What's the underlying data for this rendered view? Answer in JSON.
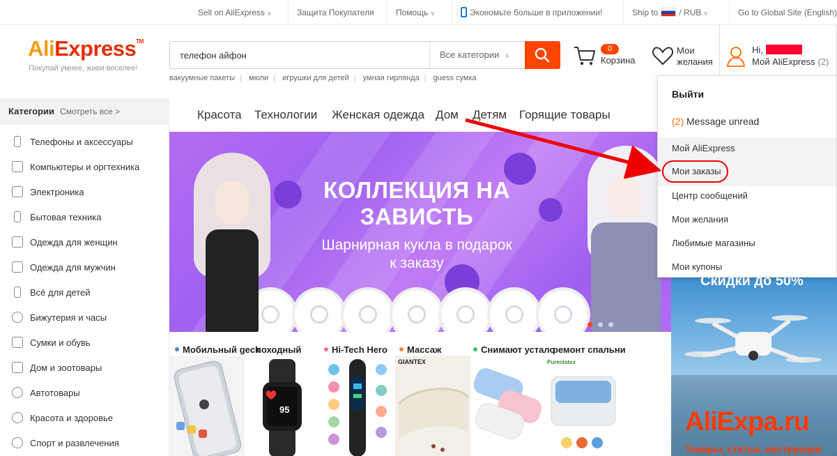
{
  "topbar": {
    "sell": "Sell on AliExpress",
    "protection": "Защита Покупателя",
    "help": "Помощь",
    "app": "Экономьте больше в приложении!",
    "ship_to": "Ship to",
    "currency": "RUB",
    "global": "Go to Global Site (English)"
  },
  "logo": {
    "part1": "Ali",
    "part2": "Express",
    "tm": "TM",
    "tagline": "Покупай умнее, живи веселее!"
  },
  "search": {
    "value": "телефон айфон",
    "category": "Все категории",
    "hotwords": [
      "вакуумные пакеты",
      "мюли",
      "игрушки для детей",
      "умная гирлянда",
      "guess сумка"
    ]
  },
  "cart": {
    "count": "0",
    "label": "Корзина"
  },
  "wishlist": {
    "label": "Мои желания"
  },
  "account": {
    "greeting": "Hi,",
    "my_aliexpress": "Мой AliExpress",
    "count": "(2)"
  },
  "dropdown": {
    "logout": "Выйти",
    "unread_count": "(2)",
    "unread_text": "Message unread",
    "items": [
      "Мой AliExpress",
      "Мои заказы",
      "Центр сообщений",
      "Мои желания",
      "Любимые магазины",
      "Мои купоны"
    ]
  },
  "categories": {
    "title": "Категории",
    "see_all": "Смотреть все >",
    "items": [
      "Телефоны и аксессуары",
      "Компьютеры и оргтехника",
      "Электроника",
      "Бытовая техника",
      "Одежда для женщин",
      "Одежда для мужчин",
      "Всё для детей",
      "Бижутерия и часы",
      "Сумки и обувь",
      "Дом и зоотовары",
      "Автотовары",
      "Красота и здоровье",
      "Спорт и развлечения"
    ]
  },
  "nav": [
    "Красота",
    "Технологии",
    "Женская одежда",
    "Дом",
    "Детям",
    "Горящие товары"
  ],
  "banner": {
    "title_line1": "КОЛЛЕКЦИЯ НА",
    "title_line2": "ЗАВИСТЬ",
    "sub_line1": "Шарнирная кукла в подарок",
    "sub_line2": "к заказу"
  },
  "products": [
    {
      "title": "Мобильный geck",
      "color": "#5b7fd6"
    },
    {
      "title": "походный",
      "color": "#ffffff"
    },
    {
      "title": "Hi-Tech Hero",
      "color": "#e8709a"
    },
    {
      "title": "Массаж",
      "color": "#f08a3c"
    },
    {
      "title": "Снимают устало",
      "color": "#42b86f"
    },
    {
      "title": "ремонт спальни",
      "color": "#ffffff"
    }
  ],
  "product_labels": {
    "watch_number": "95",
    "brand1": "GIANTEX",
    "brand2": "Purenlatex"
  },
  "promo": {
    "text": "Скидки до 50%",
    "watermark": "AliExpa.ru",
    "watermark_sub": "Товары, статьи, инструкции"
  },
  "colors": {
    "accent": "#ff4400",
    "logo_orange": "#f39c12",
    "logo_red": "#e62e04",
    "highlight": "#ee0000"
  }
}
